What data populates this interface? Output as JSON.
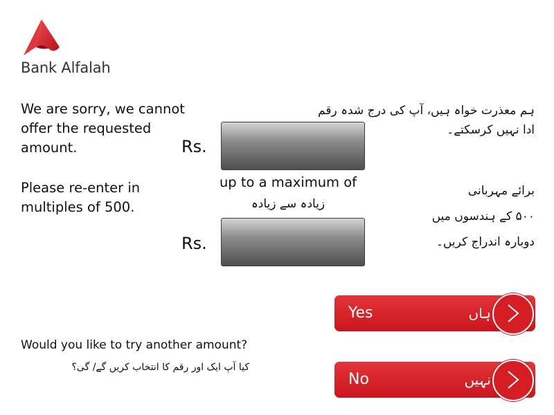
{
  "brand": {
    "name": "Bank Alfalah",
    "logo_icon": "alfalah-logo-icon",
    "color": "#d41e24"
  },
  "messages": {
    "sorry_en": "We are sorry, we cannot offer the requested amount.",
    "sorry_ur_line1": "ہم معذرت خواہ ہیں، آپ کی درج شدہ رقم",
    "sorry_ur_line2": "ادا نہیں کرسکتے۔",
    "reenter_en": "Please re-enter in multiples of 500.",
    "reenter_ur_line1": "برائے مہربانی",
    "reenter_ur_line2": "۵۰۰ کے ہندسوں میں",
    "reenter_ur_line3": "دوبارہ اندراج کریں۔"
  },
  "amounts": {
    "currency": "Rs.",
    "max_label_en": "up to a maximum of",
    "max_label_ur": "زیادہ سے زیادہ"
  },
  "question": {
    "en": "Would you like to try another amount?",
    "ur": "کیا آپ ایک اور رقم کا انتخاب کریں گے/ گی؟"
  },
  "buttons": {
    "yes": {
      "en": "Yes",
      "ur": "ہاں",
      "icon": "chevron-right-icon"
    },
    "no": {
      "en": "No",
      "ur": "نہیں",
      "icon": "chevron-right-icon"
    }
  }
}
